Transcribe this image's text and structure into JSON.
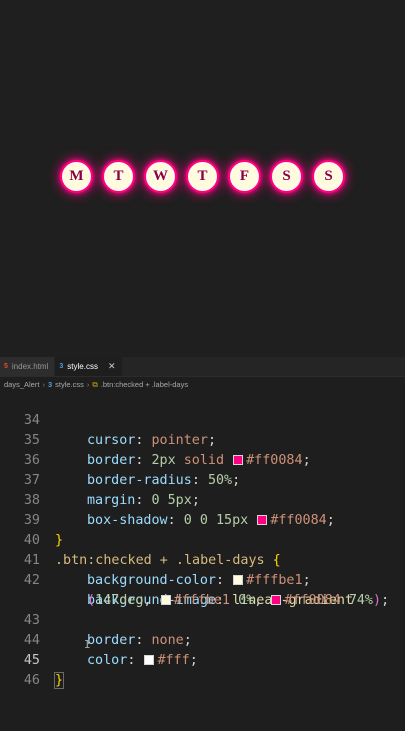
{
  "preview": {
    "days": [
      "M",
      "T",
      "W",
      "T",
      "F",
      "S",
      "S"
    ]
  },
  "tabs": [
    {
      "label": "index.html",
      "icon": "html5-icon",
      "active": false
    },
    {
      "label": "style.css",
      "icon": "css3-icon",
      "active": true
    }
  ],
  "breadcrumb": {
    "folder": "days_Alert",
    "file": "style.css",
    "symbol": ".btn:checked + .label-days"
  },
  "colors": {
    "pink": "#ff0084",
    "cream": "#fffbe1",
    "white": "#fff"
  },
  "code": {
    "l34": {
      "n": "34",
      "prop": "cursor",
      "val": "pointer"
    },
    "l35": {
      "n": "35",
      "prop": "border",
      "a": "2px",
      "b": "solid",
      "hex": "#ff0084"
    },
    "l36": {
      "n": "36",
      "prop": "border-radius",
      "num": "50%"
    },
    "l37": {
      "n": "37",
      "prop": "margin",
      "a": "0",
      "b": "5px"
    },
    "l38": {
      "n": "38",
      "prop": "box-shadow",
      "a": "0",
      "b": "0",
      "c": "15px",
      "hex": "#ff0084"
    },
    "l39": {
      "n": "39",
      "brace": "}"
    },
    "l40": {
      "n": "40",
      "sel": ".btn:checked + .label-days",
      "brace": "{"
    },
    "l41": {
      "n": "41",
      "prop": "background-color",
      "hex": "#fffbe1"
    },
    "l42": {
      "n": "42",
      "prop": "background-image",
      "func": "linear-gradient"
    },
    "l42b": {
      "deg": "147deg",
      "hex1": "#fffbe1",
      "p1": "0%",
      "hex2": "#ff0084",
      "p2": "74%"
    },
    "l43": {
      "n": "43",
      "prop": "border",
      "val": "none"
    },
    "l44": {
      "n": "44",
      "prop": "color",
      "hex": "#fff"
    },
    "l45": {
      "n": "45",
      "brace": "}"
    },
    "l46": {
      "n": "46"
    }
  }
}
